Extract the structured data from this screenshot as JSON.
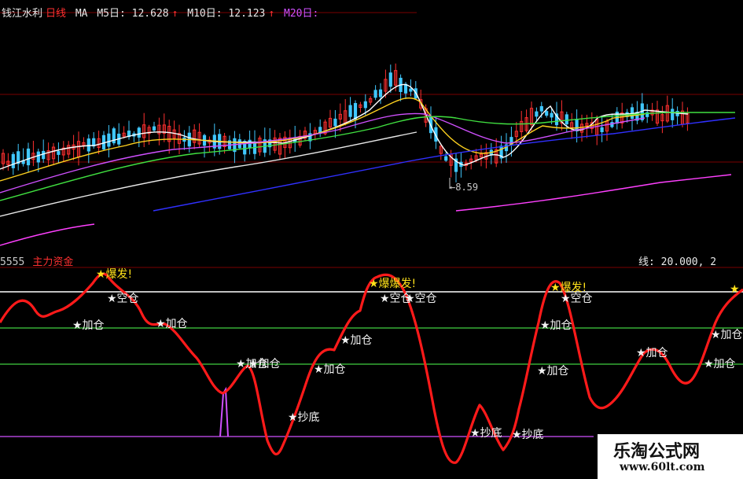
{
  "header": {
    "title": "钱江水利",
    "period": "日线",
    "ma_label": "MA",
    "ma5": "M5日: 12.628",
    "ma10": "M10日: 12.123",
    "ma20": "M20日:",
    "arrow": "↑"
  },
  "price_chart": {
    "low_label": "8.59",
    "colors": {
      "up": "#ff3030",
      "down": "#40c8ff",
      "ma5": "#ffffff",
      "ma10": "#ffd21f",
      "ma20": "#d050ff",
      "ma30": "#40e040",
      "ma60": "#3030ff",
      "long": "#ff40ff"
    }
  },
  "sub_chart": {
    "code": "5555",
    "name": "主力资金",
    "right_label": "线: 20.000, 2"
  },
  "chart_data": {
    "type": "line",
    "title": "主力资金",
    "reference_lines": [
      {
        "name": "爆发",
        "color": "#ffffff"
      },
      {
        "name": "加仓",
        "color": "#40d040"
      },
      {
        "name": "加仓",
        "color": "#40d040"
      },
      {
        "name": "抄底",
        "color": "#d050ff"
      }
    ],
    "signals": [
      {
        "text": "★爆发!",
        "kind": "burst"
      },
      {
        "text": "★空仓",
        "kind": "norm"
      },
      {
        "text": "★加仓",
        "kind": "norm"
      },
      {
        "text": "★加仓",
        "kind": "norm"
      },
      {
        "text": "★加仓",
        "kind": "norm"
      },
      {
        "text": "★加仓",
        "kind": "norm"
      },
      {
        "text": "★抄底",
        "kind": "norm"
      },
      {
        "text": "★加仓",
        "kind": "norm"
      },
      {
        "text": "★加仓",
        "kind": "norm"
      },
      {
        "text": "★爆爆发!",
        "kind": "burst"
      },
      {
        "text": "★空仓",
        "kind": "norm"
      },
      {
        "text": "★空仓",
        "kind": "norm"
      },
      {
        "text": "★抄底",
        "kind": "norm"
      },
      {
        "text": "★抄底",
        "kind": "norm"
      },
      {
        "text": "★爆发!",
        "kind": "burst"
      },
      {
        "text": "★空仓",
        "kind": "norm"
      },
      {
        "text": "★加仓",
        "kind": "norm"
      },
      {
        "text": "★加仓",
        "kind": "norm"
      },
      {
        "text": "★加仓",
        "kind": "norm"
      },
      {
        "text": "★加仓",
        "kind": "norm"
      },
      {
        "text": "★加仓",
        "kind": "norm"
      },
      {
        "text": "★",
        "kind": "burst"
      }
    ]
  },
  "watermark": {
    "site_name": "乐淘公式网",
    "url": "www.60lt.com"
  }
}
